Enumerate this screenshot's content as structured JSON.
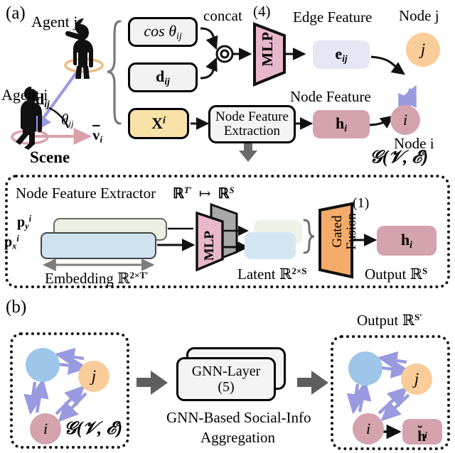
{
  "figure": {
    "panel_a_label": "(a)",
    "panel_b_label": "(b)"
  },
  "panel_a": {
    "scene": {
      "agent_j_label": "Agent j",
      "agent_i_label": "Agent i",
      "distance_vector_label": "d",
      "distance_vector_sub": "ij",
      "angle_label": "θ",
      "angle_sub": "ij",
      "velocity_label": "v",
      "velocity_sub": "i",
      "scene_label": "Scene",
      "ring_j_color": "#f0b97f",
      "ring_i_color": "#d9a0ab",
      "arrow_color": "#9a9ae0"
    },
    "inputs": {
      "cos_box": "cos θ",
      "cos_box_sub": "ij",
      "d_box": "d",
      "d_box_sub": "ij",
      "x_box": "X",
      "x_box_sup": "i",
      "x_box_color": "#f8e2a8",
      "neutral_box_color": "#f2f2f2"
    },
    "concat_label": "concat",
    "mlp": {
      "label": "MLP",
      "eq_number": "(4)",
      "color": "#e9b7cb"
    },
    "node_feature_extraction_box": "Node Feature\nExtraction",
    "edge_feature_title": "Edge Feature",
    "edge_feature_box": "e",
    "edge_feature_box_sub": "ij",
    "edge_feature_color": "#e5e7f5",
    "node_feature_title": "Node Feature",
    "node_feature_box": "h",
    "node_feature_box_sub": "i",
    "node_feature_color": "#d4a3ad",
    "node_j_label": "Node j",
    "node_i_label": "Node i",
    "node_j_letter": "j",
    "node_i_letter": "i",
    "node_j_color": "#f8cd9a",
    "node_i_color": "#d4a3ad",
    "graph_symbol": "𝒢(𝒱, ℰ)"
  },
  "extractor": {
    "title": "Node Feature Extractor",
    "mapping": "ℝ",
    "mapping_sup_from": "T′",
    "mapping_arrow": "↦",
    "mapping_sup_to": "S",
    "p_y_label": "p",
    "p_y_sub": "y",
    "p_y_sup": "i",
    "p_x_label": "p",
    "p_x_sub": "x",
    "p_x_sup": "i",
    "embedding_label": "Embedding ℝ",
    "embedding_sup": "2×T′",
    "latent_label": "Latent ℝ",
    "latent_sup": "2×S",
    "output_label": "Output ℝ",
    "output_sup": "S",
    "mlp_label": "MLP",
    "gated_fusion_label": "Gated\nFusion",
    "gated_fusion_eq": "(1)",
    "gated_fusion_color": "#f5ab6a",
    "mlp_color": "#e9b7cb",
    "mlp_shadow_color": "#a8a8a8",
    "embed_y_color": "#eaf0e2",
    "embed_x_color": "#cfe2f0",
    "latent_y_color": "#eef3e8",
    "latent_x_color": "#d5e6f3",
    "h_box": "h",
    "h_box_sub": "i",
    "h_box_color": "#d4a3ad"
  },
  "panel_b": {
    "input_graph": {
      "node_blue_color": "#9dc6e8",
      "node_j_color": "#f8cd9a",
      "node_i_color": "#d4a3ad",
      "node_j_letter": "j",
      "node_i_letter": "i",
      "graph_symbol": "𝒢(𝒱, ℰ)",
      "edge_color": "#9a9ae0"
    },
    "gnn": {
      "layer_label": "GNN-Layer",
      "eq_number": "(5)",
      "caption_line1": "GNN-Based Social-Info",
      "caption_line2": "Aggregation",
      "box_color": "#f4f4f4"
    },
    "output_graph": {
      "output_label": "Output ℝ",
      "output_sup": "S′",
      "node_blue_color": "#9dc6e8",
      "node_j_color": "#f8cd9a",
      "node_i_color": "#d4a3ad",
      "node_j_letter": "j",
      "node_i_letter": "i",
      "h_tilde_label": "h",
      "h_tilde_sub": "i",
      "h_tilde_color": "#d4a3ad",
      "edge_color": "#9a9ae0"
    },
    "block_arrow_color": "#5e5e5e"
  }
}
